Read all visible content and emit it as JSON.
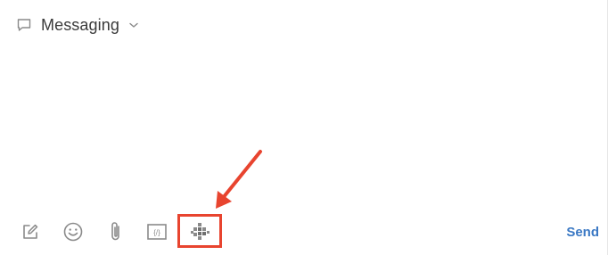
{
  "header": {
    "title": "Messaging",
    "icon": "chat-bubble-icon",
    "dropdown_icon": "chevron-down-icon"
  },
  "toolbar": {
    "items": [
      {
        "name": "compose",
        "icon": "compose-icon"
      },
      {
        "name": "emoji",
        "icon": "emoji-icon"
      },
      {
        "name": "attach",
        "icon": "paperclip-icon"
      },
      {
        "name": "macro",
        "icon": "macro-icon",
        "glyph": "⊞/⊟"
      },
      {
        "name": "apps",
        "icon": "apps-icon"
      }
    ],
    "send_label": "Send"
  },
  "annotation": {
    "highlight_color": "#e8442f",
    "target": "apps-icon"
  },
  "colors": {
    "send": "#3a78c4",
    "icon": "#8a8a8a",
    "title": "#3a3a3a"
  }
}
